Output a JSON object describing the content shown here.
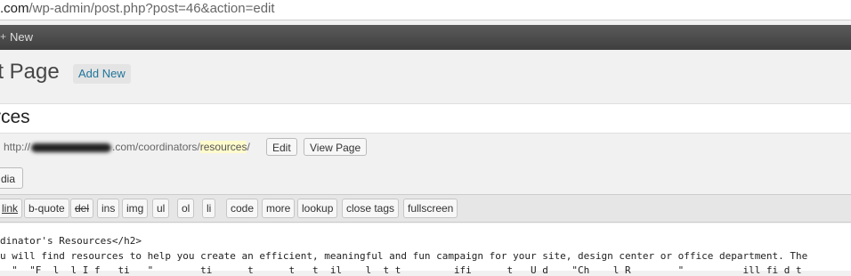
{
  "browser": {
    "url_host": ".com",
    "url_path": "/wp-admin/post.php?post=46&action=edit"
  },
  "adminbar": {
    "plus_icon": "+",
    "new_label": "New"
  },
  "page": {
    "title": "it Page",
    "add_new_label": "Add New"
  },
  "post": {
    "title": "rces"
  },
  "permalink": {
    "prefix": "http://",
    "mid": ".com/coordinators/",
    "slug": "resources",
    "suffix": "/",
    "edit_label": "Edit",
    "view_label": "View Page"
  },
  "media": {
    "label": "dia"
  },
  "toolbar": {
    "buttons": [
      "link",
      "b-quote",
      "del",
      "ins",
      "img",
      "ul",
      "ol",
      "li",
      "code",
      "more",
      "lookup",
      "close tags",
      "fullscreen"
    ]
  },
  "editor": {
    "lines": [
      "dinator's Resources</h2>",
      "u will find resources to help you create an efficient, meaningful and fun campaign for your site, design center or office department. The",
      "  \"  \"F  l  l I f   ti   \"        ti      t      t   t  il    l  t t         ifi      t   U d    \"Ch    l R        \"          ill fi d t          t  th"
    ]
  }
}
